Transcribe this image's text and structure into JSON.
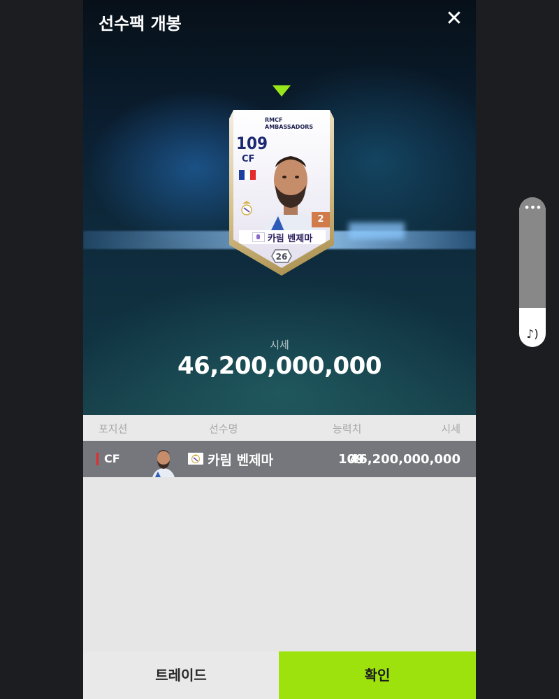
{
  "header": {
    "title": "선수팩 개봉",
    "close_label": "✕"
  },
  "card": {
    "team_line1": "RMCF",
    "team_line2": "AMBASSADORS",
    "overall": "109",
    "position": "CF",
    "level": "2",
    "name": "카림 벤제마",
    "season": "26",
    "nation_flag": [
      "#1f3fa0",
      "#ffffff",
      "#e52a2a"
    ]
  },
  "price": {
    "label": "시세",
    "value": "46,200,000,000"
  },
  "table": {
    "headers": {
      "position": "포지션",
      "name": "선수명",
      "overall": "능력치",
      "price": "시세"
    },
    "rows": [
      {
        "position": "CF",
        "name": "카림 벤제마",
        "overall": "109",
        "price": "46,200,000,000"
      }
    ]
  },
  "buttons": {
    "trade": "트레이드",
    "confirm": "확인"
  },
  "volume_widget": {
    "level": 0.74,
    "icon": "♪)"
  },
  "colors": {
    "accent": "#9ee20d",
    "row_bg": "#76777c",
    "position_marker": "#e52a2a"
  }
}
